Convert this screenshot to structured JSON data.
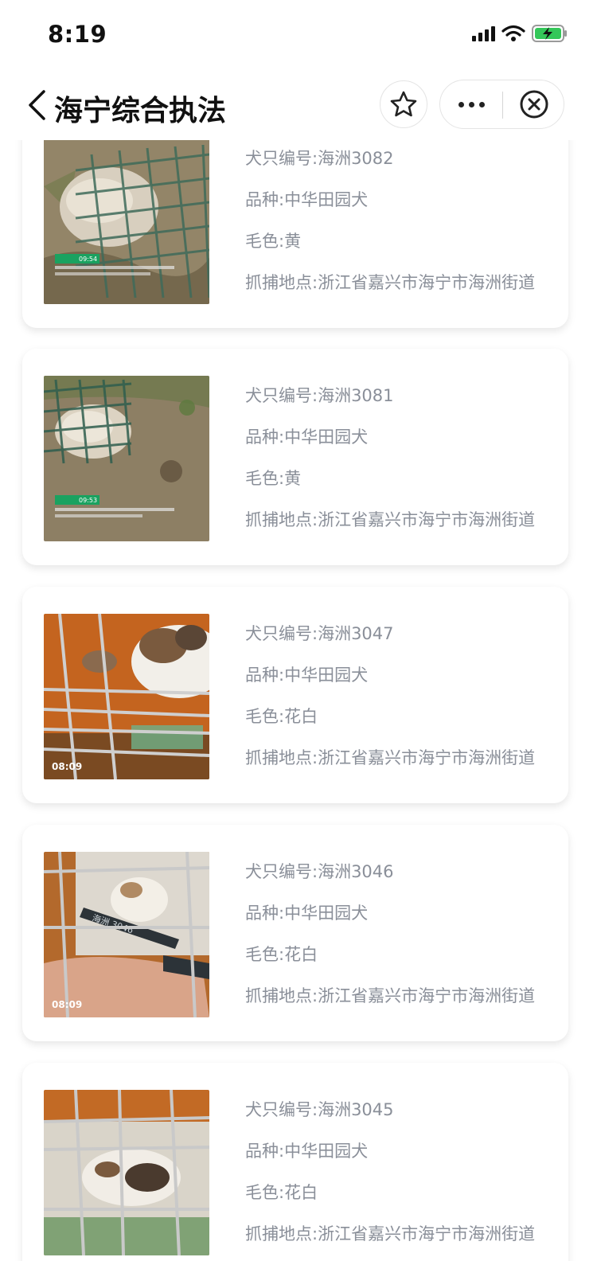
{
  "status_bar": {
    "time": "8:19"
  },
  "nav": {
    "title": "海宁综合执法"
  },
  "dogs": [
    {
      "id": "犬只编号:海洲3082",
      "breed": "品种:中华田园犬",
      "color": "毛色:黄",
      "location": "抓捕地点:浙江省嘉兴市海宁市海洲街道",
      "photo_stamp": "09:54"
    },
    {
      "id": "犬只编号:海洲3081",
      "breed": "品种:中华田园犬",
      "color": "毛色:黄",
      "location": "抓捕地点:浙江省嘉兴市海宁市海洲街道",
      "photo_stamp": "09:53"
    },
    {
      "id": "犬只编号:海洲3047",
      "breed": "品种:中华田园犬",
      "color": "毛色:花白",
      "location": "抓捕地点:浙江省嘉兴市海宁市海洲街道",
      "photo_stamp": "08:09"
    },
    {
      "id": "犬只编号:海洲3046",
      "breed": "品种:中华田园犬",
      "color": "毛色:花白",
      "location": "抓捕地点:浙江省嘉兴市海宁市海洲街道",
      "photo_stamp": "08:09",
      "tag_text": "海洲 3046"
    },
    {
      "id": "犬只编号:海洲3045",
      "breed": "品种:中华田园犬",
      "color": "毛色:花白",
      "location": "抓捕地点:浙江省嘉兴市海宁市海洲街道"
    }
  ],
  "colors": {
    "battery_green": "#34c759",
    "text_secondary": "#8a8f99"
  }
}
